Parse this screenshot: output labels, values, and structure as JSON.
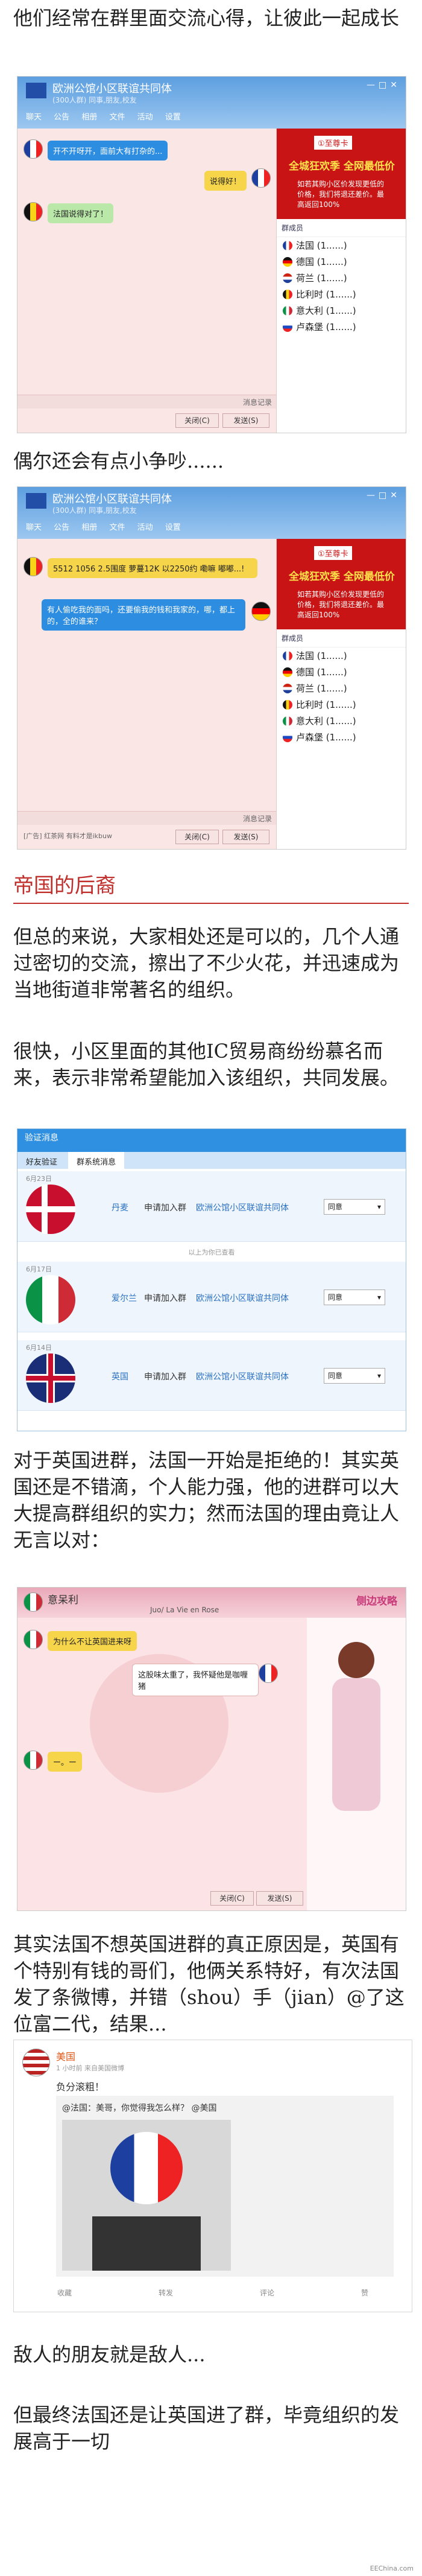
{
  "intro_1": "他们经常在群里面交流心得，让彼此一起成长",
  "intro_2": "偶尔还会有点小争吵......",
  "qq": {
    "group_title": "欧洲公馆小区联谊共同体",
    "group_sub": "(300人群) 同事,朋友,校友",
    "tools": [
      "聊天",
      "公告",
      "相册",
      "文件",
      "活动",
      "设置"
    ],
    "chat1": [
      {
        "flag": "fr",
        "text": "开不开呀开，面前大有打杂的..."
      },
      {
        "flag": "fr",
        "text": "说得好！",
        "side": "right"
      },
      {
        "flag": "be",
        "text": "法国说得对了！"
      }
    ],
    "chat2": [
      {
        "flag": "be",
        "text": "5512 1056  2.5围度  萝蔓12K  以2250约 嘞嘛  嘟嘟...!"
      },
      {
        "flag": "de",
        "text": "有人偷吃我的面吗，还要偷我的钱和我家的，哪，都上的，全的谁来？",
        "side": "right"
      }
    ],
    "ad_badge": "①至尊卡",
    "ad_title": "全城狂欢季 全网最低价",
    "ad_text": "如若其购小区价发现更低的价格，我们将退还差价。最高返回100%",
    "members_label": "群成员",
    "members1": [
      "法国 (1......)",
      "德国 (1......)",
      "荷兰 (1......)",
      "比利时 (1......)",
      "意大利 (1......)",
      "卢森堡 (1......)"
    ],
    "members2": [
      "法国 (1......)",
      "德国 (1......)",
      "荷兰 (1......)",
      "比利时 (1......)",
      "意大利 (1......)",
      "卢森堡 (1......)"
    ],
    "input_hint": "消息记录",
    "close_label": "关闭(C)",
    "send_label": "发送(S)",
    "ad_footer": "[广告] 红茶网 有料才是ikbuw"
  },
  "section_title": "帝国的后裔",
  "para_1": "但总的来说，大家相处还是可以的，几个人通过密切的交流，擦出了不少火花，并迅速成为当地街道非常著名的组织。",
  "para_2": "很快，小区里面的其他IC贸易商纷纷慕名而来，表示非常希望能加入该组织，共同发展。",
  "verify": {
    "title": "验证消息",
    "tabs": [
      "好友验证",
      "群系统消息"
    ],
    "action": "申请加入群",
    "group": "欧洲公馆小区联谊共同体",
    "select": "同意",
    "divider": "以上为你已查看",
    "rows": [
      {
        "date": "6月23日",
        "name": "丹麦",
        "flag": "dk"
      },
      {
        "date": "6月17日",
        "name": "爱尔兰",
        "flag": "it"
      },
      {
        "date": "6月14日",
        "name": "英国",
        "flag": "gb"
      }
    ]
  },
  "para_3": "对于英国进群，法国一开始是拒绝的！其实英国还是不错滴，个人能力强，他的进群可以大大提高群组织的实力；然而法国的理由竟让人无言以对：",
  "qq2": {
    "title": "意呆利",
    "sub": "Juo/ La Vie en Rose",
    "msg1": "为什么不让英国进来呀",
    "msg2": "这股味太重了，我怀疑他是咖喱猪",
    "msg3": "ー。ー",
    "side_brand": "侧边攻略"
  },
  "para_4": "其实法国不想英国进群的真正原因是，英国有个特别有钱的哥们，他俩关系特好，有次法国发了条微博，并错（shou）手（jian）@了这位富二代，结果...",
  "weibo": {
    "user": "美国",
    "time": "1 小时前  来自美国微博",
    "text": "负分滚粗！",
    "reply": "@法国：美哥，你觉得我怎么样？ @美国",
    "actions": [
      "收藏",
      "转发",
      "评论",
      "赞"
    ]
  },
  "para_5": "敌人的朋友就是敌人...",
  "para_6": "但最终法国还是让英国进了群，毕竟组织的发展高于一切",
  "credit": "EEChina.com"
}
